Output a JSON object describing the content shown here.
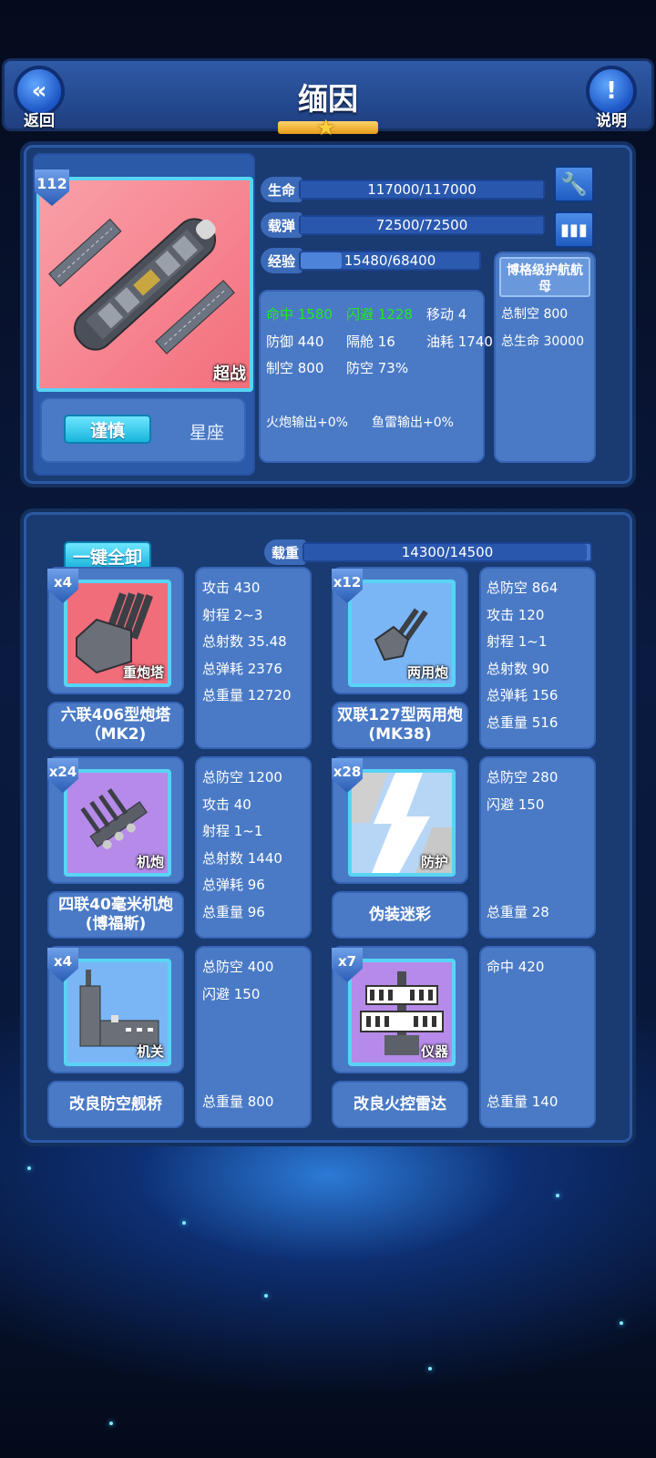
{
  "header": {
    "back_label": "返回",
    "back_icon": "double-chevron-left-icon",
    "title": "缅因",
    "help_label": "说明",
    "help_icon": "exclamation-icon",
    "stars": 1
  },
  "ship": {
    "level": "112",
    "type_tag": "超战",
    "stance_button": "谨慎",
    "constellation_label": "星座",
    "hull_class": "博格级护航航母"
  },
  "bars": [
    {
      "label": "生命",
      "text": "117000/117000",
      "fraction": 1.0
    },
    {
      "label": "载弹",
      "text": "72500/72500",
      "fraction": 1.0
    },
    {
      "label": "经验",
      "text": "15480/68400",
      "fraction": 0.23
    }
  ],
  "stats": {
    "hit": "命中 1580",
    "evade": "闪避 1228",
    "move": "移动 4",
    "defense": "防御 440",
    "bulkhead": "隔舱 16",
    "fuel": "油耗 1740",
    "air_control": "制空 800",
    "aa": "防空 73%",
    "gun_output": "火炮输出+0%",
    "torpedo_output": "鱼雷输出+0%"
  },
  "side_stats": {
    "total_air": "总制空 800",
    "total_hp": "总生命 30000"
  },
  "load": {
    "unequip_all": "一键全卸",
    "label": "载重",
    "text": "14300/14500",
    "fraction": 0.986
  },
  "equipment": [
    {
      "count": "x4",
      "tag": "重炮塔",
      "name": "六联406型炮塔（MK2)",
      "stats": [
        "攻击 430",
        "射程 2~3",
        "总射数 35.48",
        "总弹耗 2376",
        "总重量 12720"
      ],
      "bottom": "",
      "bg": "#f26d7a"
    },
    {
      "count": "x12",
      "tag": "两用炮",
      "name": "双联127型两用炮(MK38)",
      "stats": [
        "总防空 864",
        "攻击 120",
        "射程 1~1",
        "总射数 90",
        "总弹耗 156"
      ],
      "bottom": "总重量 516",
      "bg": "#7ab6f5"
    },
    {
      "count": "x24",
      "tag": "机炮",
      "name": "四联40毫米机炮(博福斯)",
      "stats": [
        "总防空 1200",
        "攻击 40",
        "射程 1~1",
        "总射数 1440",
        "总弹耗 96"
      ],
      "bottom": "总重量 96",
      "bg": "#b58ae8"
    },
    {
      "count": "x28",
      "tag": "防护",
      "name": "伪装迷彩",
      "stats": [
        "总防空 280",
        "闪避 150"
      ],
      "bottom": "总重量 28",
      "bg": "#7ab6f5"
    },
    {
      "count": "x4",
      "tag": "机关",
      "name": "改良防空舰桥",
      "stats": [
        "总防空 400",
        "闪避 150"
      ],
      "bottom": "总重量 800",
      "bg": "#7ab6f5"
    },
    {
      "count": "x7",
      "tag": "仪器",
      "name": "改良火控雷达",
      "stats": [
        "命中 420"
      ],
      "bottom": "总重量 140",
      "bg": "#b58ae8"
    }
  ]
}
